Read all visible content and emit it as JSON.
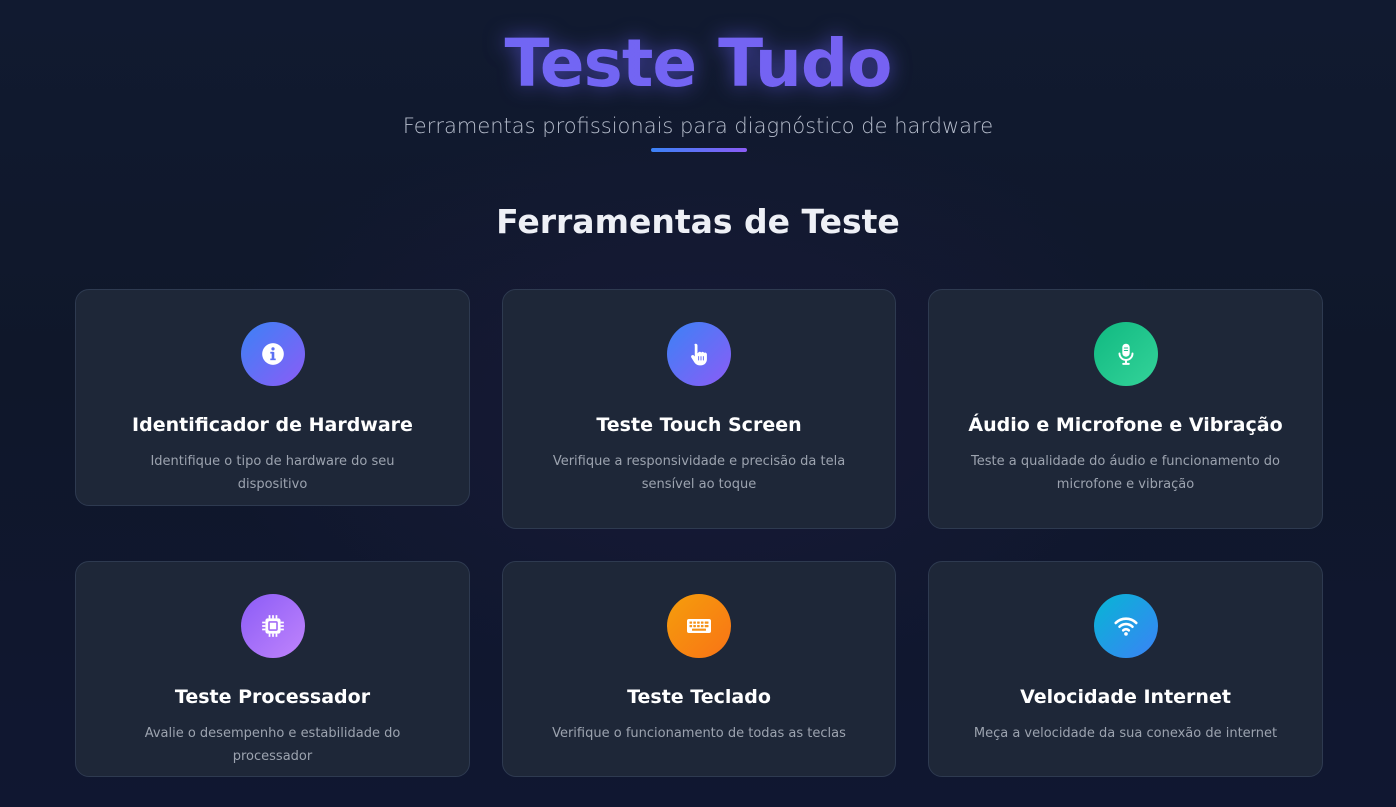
{
  "header": {
    "title": "Teste Tudo",
    "subtitle": "Ferramentas profissionais para diagnóstico de hardware"
  },
  "section": {
    "title": "Ferramentas de Teste"
  },
  "tools": [
    {
      "title": "Identificador de Hardware",
      "description": "Identifique o tipo de hardware do seu dispositivo",
      "icon": "info-icon",
      "gradient": [
        "#3b82f6",
        "#8b5cf6"
      ]
    },
    {
      "title": "Teste Touch Screen",
      "description": "Verifique a responsividade e precisão da tela sensível ao toque",
      "icon": "pointer-hand-icon",
      "gradient": [
        "#3b82f6",
        "#8b5cf6"
      ]
    },
    {
      "title": "Áudio e Microfone e Vibração",
      "description": "Teste a qualidade do áudio e funcionamento do microfone e vibração",
      "icon": "microphone-icon",
      "gradient": [
        "#10b981",
        "#34d399"
      ]
    },
    {
      "title": "Teste Processador",
      "description": "Avalie o desempenho e estabilidade do processador",
      "icon": "cpu-chip-icon",
      "gradient": [
        "#8b5cf6",
        "#c084fc"
      ]
    },
    {
      "title": "Teste Teclado",
      "description": "Verifique o funcionamento de todas as teclas",
      "icon": "keyboard-icon",
      "gradient": [
        "#f59e0b",
        "#f97316"
      ]
    },
    {
      "title": "Velocidade Internet",
      "description": "Meça a velocidade da sua conexão de internet",
      "icon": "wifi-icon",
      "gradient": [
        "#06b6d4",
        "#3b82f6"
      ]
    }
  ],
  "colors": {
    "background": "#0f172a",
    "card_background": "#1e2738",
    "card_border": "#2e3a50",
    "title_gradient": [
      "#6b6cf6",
      "#7c5cf0"
    ],
    "underline_gradient": [
      "#3b82f6",
      "#8b5cf6"
    ]
  }
}
